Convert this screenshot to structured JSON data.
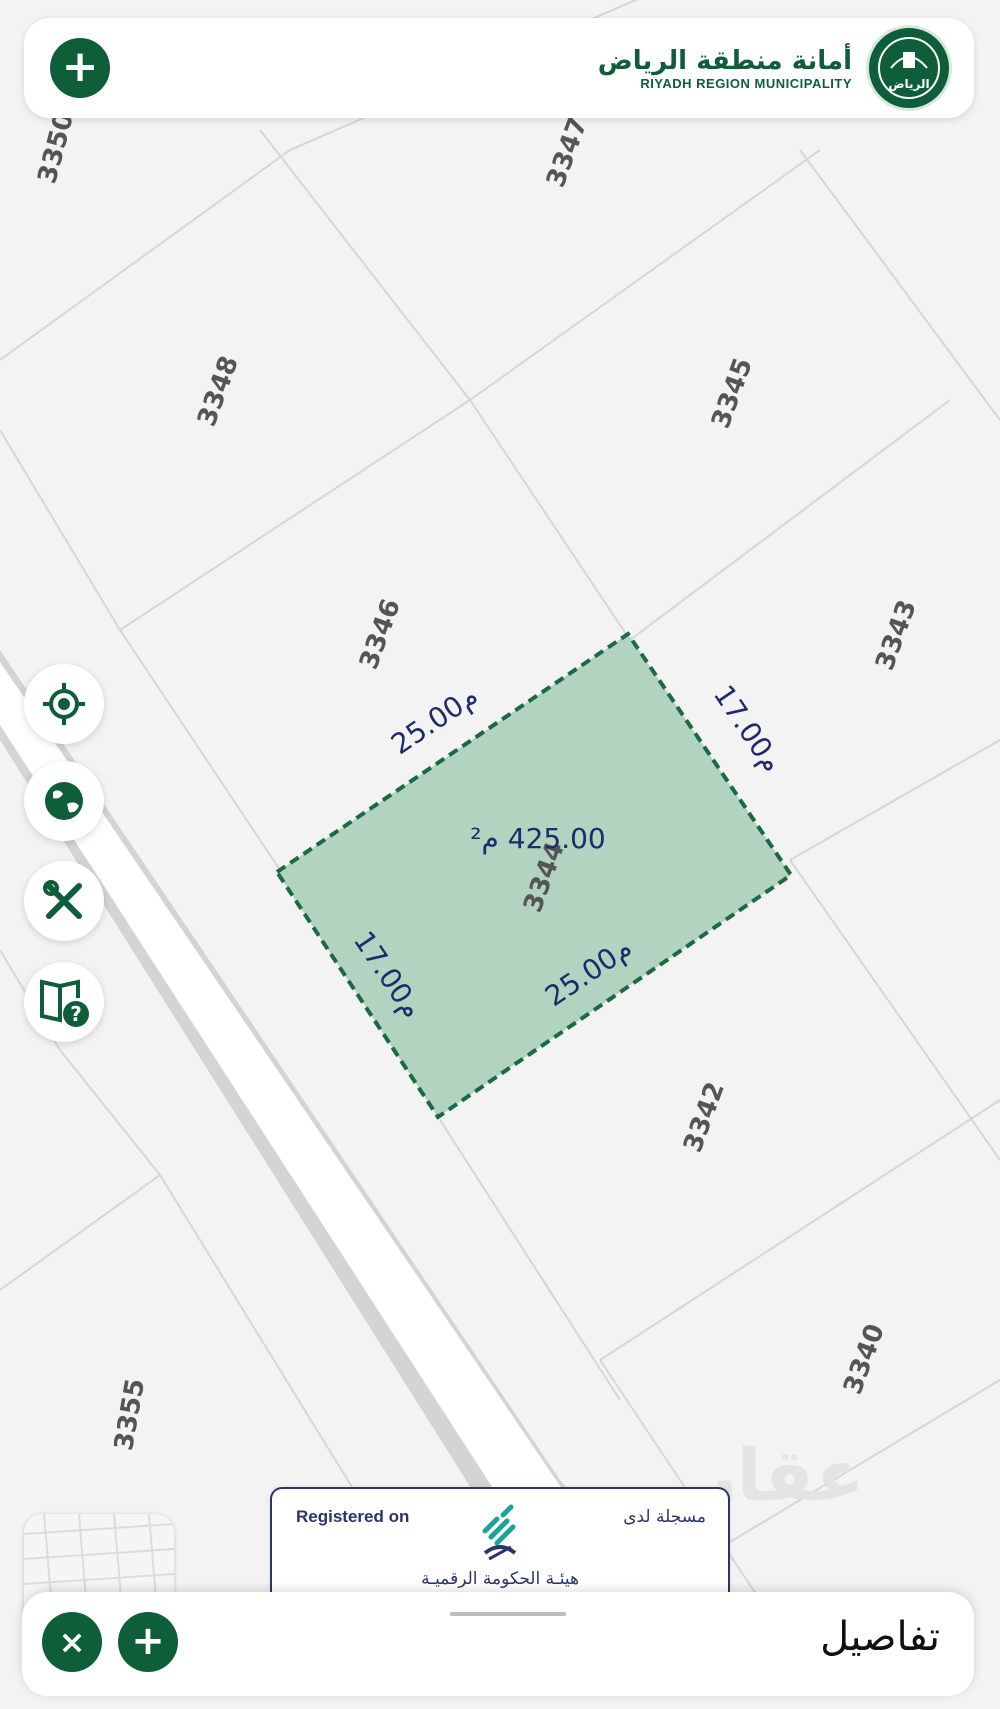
{
  "header": {
    "logo_ar": "أمانة منطقة الرياض",
    "logo_en": "RIYADH REGION MUNICIPALITY",
    "seal_text": "الرياض",
    "add_button": "+"
  },
  "map": {
    "parcels": [
      "3350",
      "3347",
      "3348",
      "3345",
      "3346",
      "3343",
      "3342",
      "3340",
      "3355"
    ],
    "selected_parcel": {
      "number": "3344",
      "area": "425.00 م²",
      "side_top": "25.00م",
      "side_right": "17.00م",
      "side_bottom": "25.00م",
      "side_left": "17.00م"
    },
    "colors": {
      "fill": "#b3d3c1",
      "border": "#1a6a42",
      "road": "#ffffff"
    }
  },
  "side_controls": [
    "locate-icon",
    "globe-icon",
    "tools-icon",
    "help-book-icon"
  ],
  "registered": {
    "en": "Registered on",
    "ar": "مسجلة لدى",
    "authority": "هيئـة الحكومة الرقميـة"
  },
  "bottom_sheet": {
    "title": "تفاصيل",
    "close": "×",
    "add": "+"
  },
  "watermark": "عقار"
}
